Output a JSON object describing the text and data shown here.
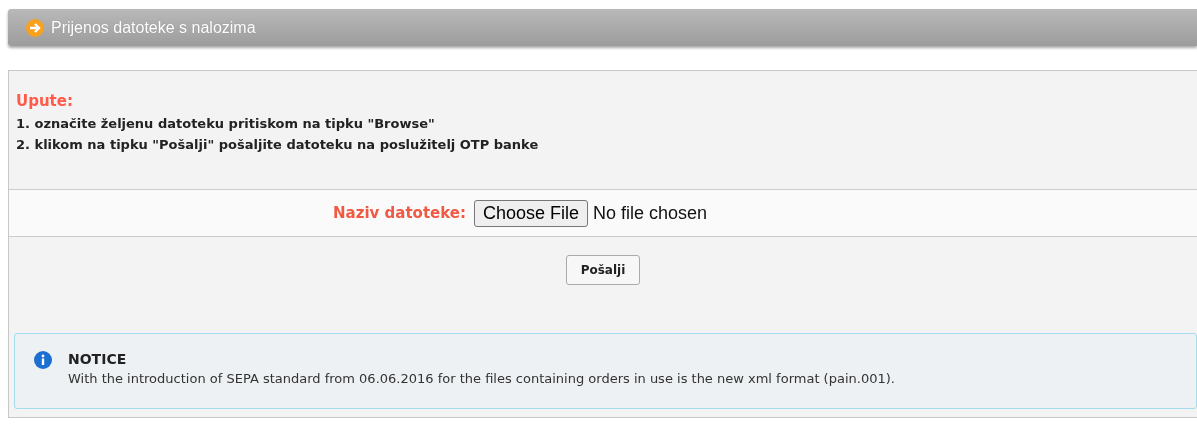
{
  "header": {
    "title": "Prijenos datoteke s nalozima"
  },
  "instructions": {
    "heading": "Upute:",
    "steps": [
      "1. označite željenu datoteku pritiskom na tipku \"Browse\"",
      "2. klikom na tipku \"Pošalji\" pošaljite datoteku na poslužitelj OTP banke"
    ]
  },
  "file_field": {
    "label": "Naziv datoteke:",
    "button": "Choose File",
    "status": "No file chosen"
  },
  "submit_button": "Pošalji",
  "notice": {
    "title": "NOTICE",
    "text": "With the introduction of SEPA standard from 06.06.2016 for the files containing orders in use is the new xml format (pain.001)."
  }
}
